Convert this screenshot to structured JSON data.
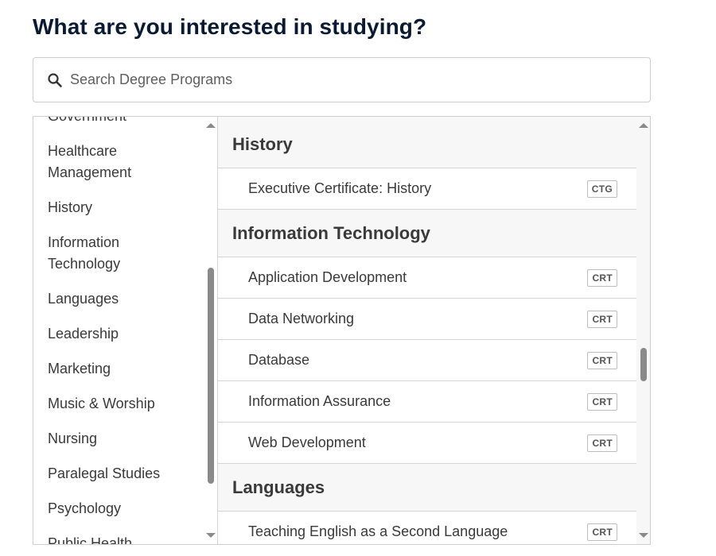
{
  "page": {
    "title": "What are you interested in studying?"
  },
  "search": {
    "placeholder": "Search Degree Programs",
    "value": "",
    "icon": "search-icon"
  },
  "categories": [
    {
      "label": "Government"
    },
    {
      "label": "Healthcare Management"
    },
    {
      "label": "History"
    },
    {
      "label": "Information Technology"
    },
    {
      "label": "Languages"
    },
    {
      "label": "Leadership"
    },
    {
      "label": "Marketing"
    },
    {
      "label": "Music & Worship"
    },
    {
      "label": "Nursing"
    },
    {
      "label": "Paralegal Studies"
    },
    {
      "label": "Psychology"
    },
    {
      "label": "Public Health"
    }
  ],
  "program_groups": [
    {
      "heading": "History",
      "programs": [
        {
          "name": "Executive Certificate: History",
          "badge": "CTG"
        }
      ]
    },
    {
      "heading": "Information Technology",
      "programs": [
        {
          "name": "Application Development",
          "badge": "CRT"
        },
        {
          "name": "Data Networking",
          "badge": "CRT"
        },
        {
          "name": "Database",
          "badge": "CRT"
        },
        {
          "name": "Information Assurance",
          "badge": "CRT"
        },
        {
          "name": "Web Development",
          "badge": "CRT"
        }
      ]
    },
    {
      "heading": "Languages",
      "programs": [
        {
          "name": "Teaching English as a Second Language",
          "badge": "CRT"
        }
      ]
    }
  ],
  "colors": {
    "title": "#0b1a33",
    "text": "#3a3a3a",
    "border": "#cfcfcf",
    "group_bg": "#f7f7f8",
    "scroll_thumb": "#8a8a8a"
  }
}
